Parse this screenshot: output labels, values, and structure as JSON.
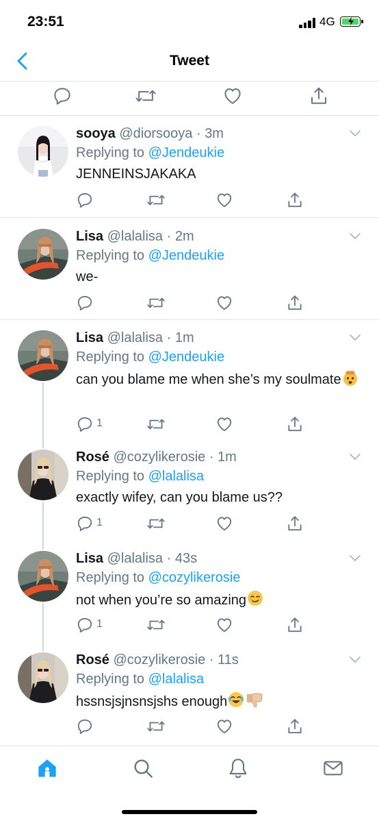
{
  "status_bar": {
    "time": "23:51",
    "network": "4G"
  },
  "nav": {
    "title": "Tweet"
  },
  "tweets": [
    {
      "name": "sooya",
      "handle": "@diorsooya",
      "time": "3m",
      "replying_prefix": "Replying to ",
      "replying_to": "@Jendeukie",
      "text": "JENNEINSJAKAKA",
      "reply_count": ""
    },
    {
      "name": "Lisa",
      "handle": "@lalalisa",
      "time": "2m",
      "replying_prefix": "Replying to ",
      "replying_to": "@Jendeukie",
      "text": "we-",
      "reply_count": ""
    },
    {
      "name": "Lisa",
      "handle": "@lalalisa",
      "time": "1m",
      "replying_prefix": "Replying to ",
      "replying_to": "@Jendeukie",
      "text": "can you blame me when she’s my soulmate",
      "reply_count": "1"
    },
    {
      "name": "Rosé",
      "handle": "@cozylikerosie",
      "time": "1m",
      "replying_prefix": "Replying to ",
      "replying_to": "@lalalisa",
      "text": "exactly wifey, can you blame us??",
      "reply_count": "1"
    },
    {
      "name": "Lisa",
      "handle": "@lalalisa",
      "time": "43s",
      "replying_prefix": "Replying to ",
      "replying_to": "@cozylikerosie",
      "text": "not when you’re so amazing",
      "reply_count": "1"
    },
    {
      "name": "Rosé",
      "handle": "@cozylikerosie",
      "time": "11s",
      "replying_prefix": "Replying to ",
      "replying_to": "@lalalisa",
      "text": "hssnsjsjnsnsjshs enough",
      "reply_count": ""
    }
  ],
  "separator": " · ",
  "tab_bar": {
    "tabs": [
      "home-icon",
      "search-icon",
      "notifications-icon",
      "messages-icon"
    ],
    "active": "home-icon"
  },
  "colors": {
    "accent": "#1da1f2",
    "muted": "#657786",
    "text": "#14171a",
    "divider": "#dfe3e6"
  }
}
